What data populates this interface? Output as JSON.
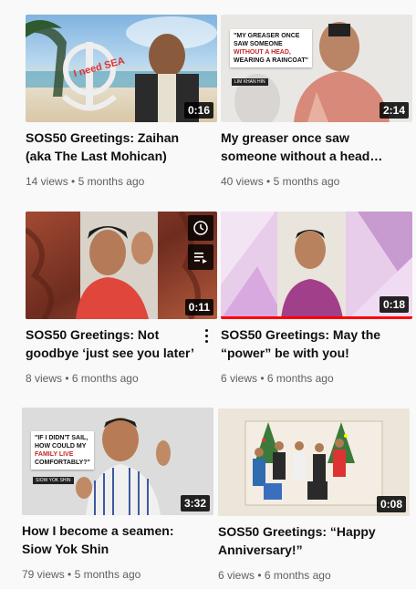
{
  "videos": [
    {
      "title_line1": "SOS50 Greetings: Zaihan",
      "title_line2": "(aka The Last Mohican)",
      "views": "14 views",
      "age": "5 months ago",
      "duration": "0:16",
      "thumb_text": "I need SEA"
    },
    {
      "title_line1": "My greaser once saw",
      "title_line2": "someone without a head…",
      "views": "40 views",
      "age": "5 months ago",
      "duration": "2:14",
      "thumb_caption_line1": "\"MY GREASER ONCE",
      "thumb_caption_line2": "SAW SOMEONE",
      "thumb_caption_line3": "WITHOUT A HEAD,",
      "thumb_caption_line4": "WEARING A RAINCOAT\"",
      "thumb_name": "LIM KHAN HIN"
    },
    {
      "title_line1": "SOS50 Greetings: Not",
      "title_line2": "goodbye ‘just see you later’",
      "views": "8 views",
      "age": "6 months ago",
      "duration": "0:11"
    },
    {
      "title_line1": "SOS50 Greetings: May the",
      "title_line2": "“power” be with you!",
      "views": "6 views",
      "age": "6 months ago",
      "duration": "0:18",
      "watched_fraction": 1.0
    },
    {
      "title_line1": "How I become a seamen:",
      "title_line2": "Siow Yok Shin",
      "views": "79 views",
      "age": "5 months ago",
      "duration": "3:32",
      "thumb_caption_line1": "\"IF I DIDN'T SAIL,",
      "thumb_caption_line2": "HOW COULD MY",
      "thumb_caption_line3": "FAMILY LIVE",
      "thumb_caption_line4": "COMFORTABLY?\"",
      "thumb_name": "SIOW YOK SHIN"
    },
    {
      "title_line1": "SOS50 Greetings: “Happy",
      "title_line2": "Anniversary!”",
      "views": "6 views",
      "age": "6 months ago",
      "duration": "0:08"
    }
  ],
  "separator": "•",
  "colors": {
    "background": "#f9f9f9",
    "progress": "#ff0000",
    "meta_text": "#606060"
  }
}
